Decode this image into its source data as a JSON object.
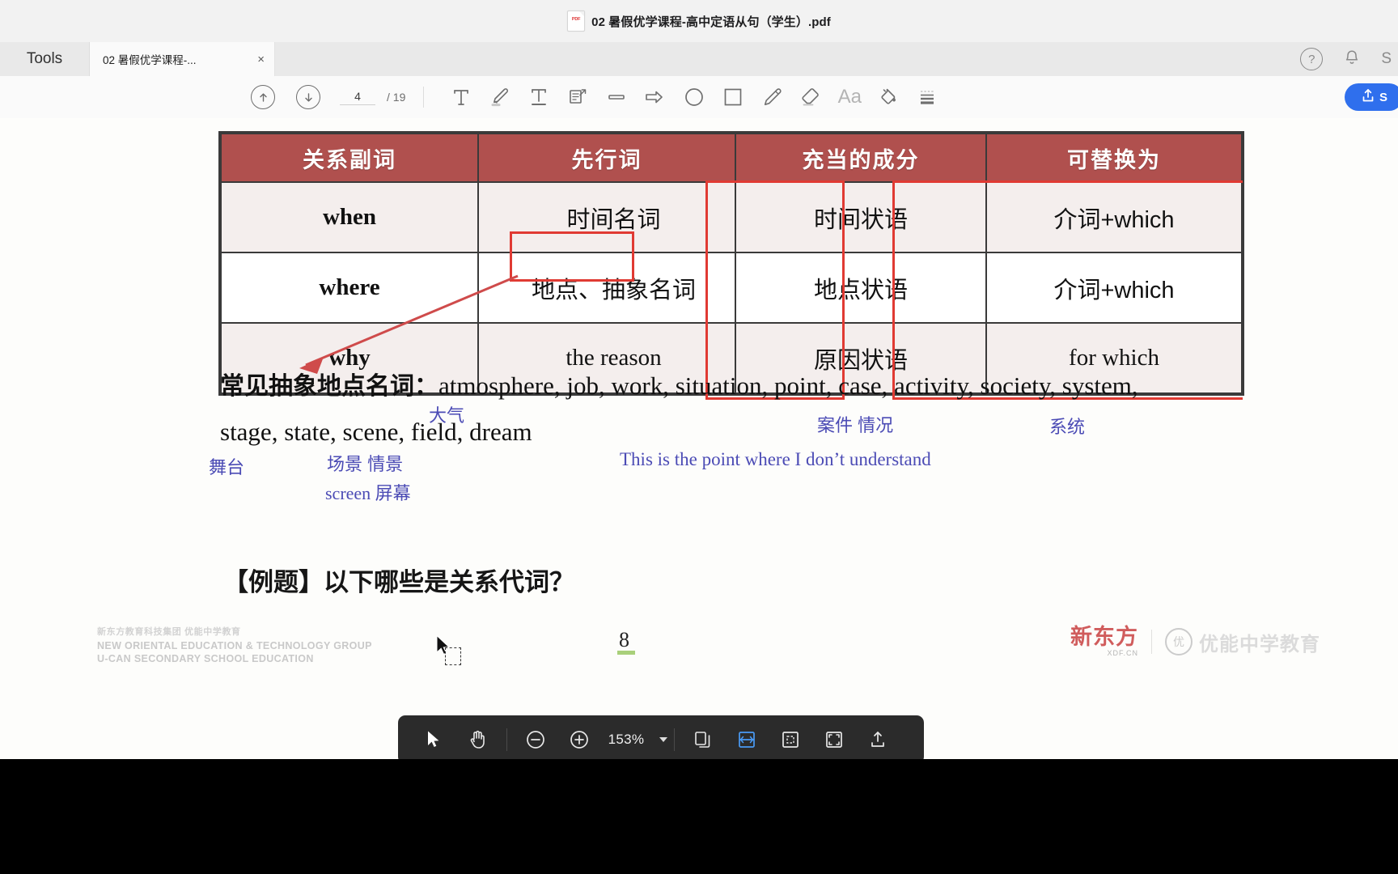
{
  "window": {
    "title": "02 暑假优学课程-高中定语从句（学生）.pdf",
    "pdf_icon": "pdf-file-icon"
  },
  "tabbar": {
    "tools_label": "Tools",
    "tab_label": "02 暑假优学课程-...",
    "close_glyph": "×",
    "help_glyph": "?",
    "bell_glyph": "▲",
    "s_label": "S"
  },
  "toolbar": {
    "prev_page_icon": "arrow-up-circle-icon",
    "next_page_icon": "arrow-down-circle-icon",
    "page_current": "4",
    "page_total": "/ 19",
    "tools": [
      {
        "name": "text-tool",
        "icon": "text-T-icon"
      },
      {
        "name": "highlighter-tool",
        "icon": "highlighter-pen-icon"
      },
      {
        "name": "underline-tool",
        "icon": "underline-T-icon"
      },
      {
        "name": "note-tool",
        "icon": "note-callout-icon"
      },
      {
        "name": "line-tool",
        "icon": "line-icon"
      },
      {
        "name": "arrow-tool",
        "icon": "arrow-right-icon"
      },
      {
        "name": "ellipse-tool",
        "icon": "circle-icon"
      },
      {
        "name": "rectangle-tool",
        "icon": "square-icon"
      },
      {
        "name": "pencil-tool",
        "icon": "pencil-icon"
      },
      {
        "name": "eraser-tool",
        "icon": "eraser-icon"
      },
      {
        "name": "font-tool",
        "icon": "Aa-icon",
        "label": "Aa"
      },
      {
        "name": "fill-color-tool",
        "icon": "paint-bucket-icon"
      },
      {
        "name": "line-style-tool",
        "icon": "line-weight-icon"
      }
    ],
    "share_label": "S",
    "share_icon": "share-upload-icon"
  },
  "document": {
    "table": {
      "headers": [
        "关系副词",
        "先行词",
        "充当的成分",
        "可替换为"
      ],
      "rows": [
        {
          "adverb": "when",
          "antecedent": "时间名词",
          "role": "时间状语",
          "replace": "介词+which"
        },
        {
          "adverb": "where",
          "antecedent": "地点、抽象名词",
          "antecedent_plain": "地点、",
          "antecedent_boxed": "抽象名词",
          "role": "地点状语",
          "replace": "介词+which"
        },
        {
          "adverb": "why",
          "antecedent": "the reason",
          "role": "原因状语",
          "replace": "for which"
        }
      ]
    },
    "common_nouns_label": "常见抽象地点名词",
    "common_nouns_colon": "：",
    "common_nouns_line1": "atmosphere, job, work, situation, point, case, activity, society, system,",
    "common_nouns_line2": "stage, state, scene, field, dream",
    "annotations": [
      {
        "text": "大气",
        "name": "annotation-atmosphere"
      },
      {
        "text": "案件 情况",
        "name": "annotation-case-situation"
      },
      {
        "text": "系统",
        "name": "annotation-system"
      },
      {
        "text": "舞台",
        "name": "annotation-stage"
      },
      {
        "text": "场景 情景",
        "name": "annotation-scene"
      },
      {
        "text": "screen 屏幕",
        "name": "annotation-screen"
      },
      {
        "text": "This is the point where I don’t understand",
        "name": "annotation-example-sentence"
      }
    ],
    "example_heading": "【例题】以下哪些是关系代词？",
    "footer": {
      "cn_line": "新东方教育科技集团  优能中学教育",
      "en_line1": "NEW ORIENTAL EDUCATION & TECHNOLOGY GROUP",
      "en_line2": "U-CAN SECONDARY SCHOOL EDUCATION",
      "page_number": "8",
      "brand_xdf": "新东方",
      "brand_xdf_sub": "XDF.CN",
      "brand_ucan": "优能中学教育"
    }
  },
  "bottombar": {
    "select_icon": "cursor-arrow-icon",
    "pan_icon": "hand-icon",
    "zoom_out_icon": "minus-circle-icon",
    "zoom_in_icon": "plus-circle-icon",
    "zoom_value": "153%",
    "dropdown_icon": "chevron-down-icon",
    "copy_icon": "copy-pages-icon",
    "fit_width_icon": "fit-width-icon",
    "fit_page_icon": "fit-page-icon",
    "full_screen_icon": "expand-icon",
    "export_icon": "upload-icon"
  },
  "colors": {
    "header_red": "#b0504e",
    "annotation_red": "#e03a33",
    "annotation_blue": "#4b4bb5",
    "accent_blue": "#2f6fed",
    "toolbar_dark": "#2b2b2b"
  }
}
